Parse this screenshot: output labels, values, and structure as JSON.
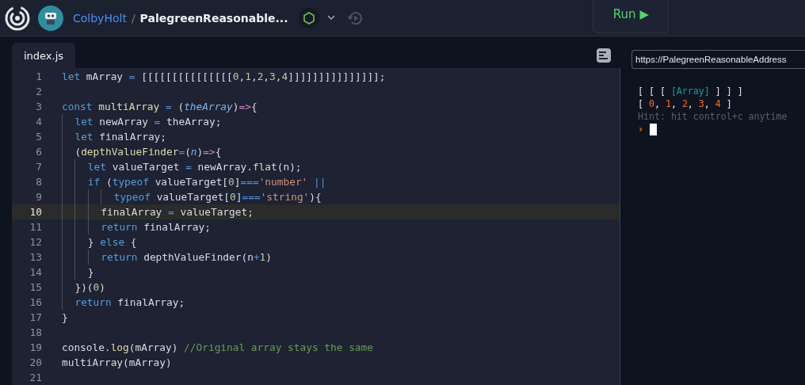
{
  "header": {
    "user": "ColbyHolt",
    "separator": "/",
    "repl_name": "PalegreenReasonable...",
    "run_button": {
      "label": "Run",
      "icon": "▶"
    }
  },
  "editor": {
    "tabs": [
      {
        "label": "index.js",
        "selected": true
      }
    ],
    "lines": [
      {
        "number": "1",
        "current": false,
        "tokens": [
          {
            "kind": "kw",
            "text": "let"
          },
          {
            "kind": "plain",
            "text": " mArray "
          },
          {
            "kind": "op",
            "text": "="
          },
          {
            "kind": "plain",
            "text": " [[[[[[[[[[[[[[["
          },
          {
            "kind": "num",
            "text": "0"
          },
          {
            "kind": "plain",
            "text": ","
          },
          {
            "kind": "num",
            "text": "1"
          },
          {
            "kind": "plain",
            "text": ","
          },
          {
            "kind": "num",
            "text": "2"
          },
          {
            "kind": "plain",
            "text": ","
          },
          {
            "kind": "num",
            "text": "3"
          },
          {
            "kind": "plain",
            "text": ","
          },
          {
            "kind": "num",
            "text": "4"
          },
          {
            "kind": "plain",
            "text": "]]]]]]]]]]]]]]];"
          }
        ]
      },
      {
        "number": "2",
        "current": false
      },
      {
        "number": "3",
        "current": false,
        "tokens": [
          {
            "kind": "kw",
            "text": "const "
          },
          {
            "kind": "fn",
            "text": "multiArray"
          },
          {
            "kind": "op",
            "text": " = "
          },
          {
            "kind": "plain",
            "text": "("
          },
          {
            "kind": "param",
            "text": "theArray"
          },
          {
            "kind": "plain",
            "text": ")"
          },
          {
            "kind": "arrow",
            "text": "=>"
          },
          {
            "kind": "plain",
            "text": "{"
          }
        ]
      },
      {
        "number": "4",
        "current": false,
        "tokens": [
          {
            "kind": "kw",
            "text": "  let"
          },
          {
            "kind": "plain",
            "text": " newArray "
          },
          {
            "kind": "op",
            "text": "="
          },
          {
            "kind": "plain",
            "text": " theArray;"
          }
        ]
      },
      {
        "number": "5",
        "current": false,
        "tokens": [
          {
            "kind": "kw",
            "text": "  let"
          },
          {
            "kind": "plain",
            "text": " finalArray;"
          }
        ]
      },
      {
        "number": "6",
        "current": false,
        "tokens": [
          {
            "kind": "plain",
            "text": "  ("
          },
          {
            "kind": "fn",
            "text": "depthValueFinder"
          },
          {
            "kind": "op",
            "text": "="
          },
          {
            "kind": "plain",
            "text": "("
          },
          {
            "kind": "param",
            "text": "n"
          },
          {
            "kind": "plain",
            "text": ")"
          },
          {
            "kind": "arrow",
            "text": "=>"
          },
          {
            "kind": "plain",
            "text": "{"
          }
        ]
      },
      {
        "number": "7",
        "current": false,
        "tokens": [
          {
            "kind": "kw",
            "text": "    let"
          },
          {
            "kind": "plain",
            "text": " valueTarget "
          },
          {
            "kind": "op",
            "text": "="
          },
          {
            "kind": "plain",
            "text": " newArray."
          },
          {
            "kind": "fn",
            "text": "flat"
          },
          {
            "kind": "plain",
            "text": "(n);"
          }
        ]
      },
      {
        "number": "8",
        "current": false,
        "tokens": [
          {
            "kind": "kw",
            "text": "    if"
          },
          {
            "kind": "plain",
            "text": " ("
          },
          {
            "kind": "kw",
            "text": "typeof"
          },
          {
            "kind": "plain",
            "text": " valueTarget["
          },
          {
            "kind": "num",
            "text": "0"
          },
          {
            "kind": "plain",
            "text": "]"
          },
          {
            "kind": "op",
            "text": "==="
          },
          {
            "kind": "str",
            "text": "'number'"
          },
          {
            "kind": "op",
            "text": " ||"
          }
        ]
      },
      {
        "number": "9",
        "current": false,
        "tokens": [
          {
            "kind": "kw",
            "text": "        typeof"
          },
          {
            "kind": "plain",
            "text": " valueTarget["
          },
          {
            "kind": "num",
            "text": "0"
          },
          {
            "kind": "plain",
            "text": "]"
          },
          {
            "kind": "op",
            "text": "==="
          },
          {
            "kind": "str",
            "text": "'string'"
          },
          {
            "kind": "plain",
            "text": "){"
          }
        ]
      },
      {
        "number": "10",
        "current": true,
        "tokens": [
          {
            "kind": "plain",
            "text": "      finalArray "
          },
          {
            "kind": "op",
            "text": "="
          },
          {
            "kind": "plain",
            "text": " valueTarget;"
          }
        ]
      },
      {
        "number": "11",
        "current": false,
        "tokens": [
          {
            "kind": "kw",
            "text": "      return"
          },
          {
            "kind": "plain",
            "text": " finalArray;"
          }
        ]
      },
      {
        "number": "12",
        "current": false,
        "tokens": [
          {
            "kind": "plain",
            "text": "    } "
          },
          {
            "kind": "kw",
            "text": "else"
          },
          {
            "kind": "plain",
            "text": " {"
          }
        ]
      },
      {
        "number": "13",
        "current": false,
        "tokens": [
          {
            "kind": "kw",
            "text": "      return"
          },
          {
            "kind": "plain",
            "text": " depthValueFinder(n"
          },
          {
            "kind": "op",
            "text": "+"
          },
          {
            "kind": "num",
            "text": "1"
          },
          {
            "kind": "plain",
            "text": ")"
          }
        ]
      },
      {
        "number": "14",
        "current": false,
        "tokens": [
          {
            "kind": "plain",
            "text": "    }"
          }
        ]
      },
      {
        "number": "15",
        "current": false,
        "tokens": [
          {
            "kind": "plain",
            "text": "  })("
          },
          {
            "kind": "num",
            "text": "0"
          },
          {
            "kind": "plain",
            "text": ")"
          }
        ]
      },
      {
        "number": "16",
        "current": false,
        "tokens": [
          {
            "kind": "kw",
            "text": "  return"
          },
          {
            "kind": "plain",
            "text": " finalArray;"
          }
        ]
      },
      {
        "number": "17",
        "current": false,
        "tokens": [
          {
            "kind": "plain",
            "text": "}"
          }
        ]
      },
      {
        "number": "18",
        "current": false
      },
      {
        "number": "19",
        "current": false,
        "tokens": [
          {
            "kind": "plain",
            "text": "console."
          },
          {
            "kind": "fn",
            "text": "log"
          },
          {
            "kind": "plain",
            "text": "(mArray) "
          },
          {
            "kind": "comment",
            "text": "//Original array stays the same"
          }
        ]
      },
      {
        "number": "20",
        "current": false,
        "tokens": [
          {
            "kind": "plain",
            "text": "multiArray(mArray)"
          }
        ]
      },
      {
        "number": "21",
        "current": false
      }
    ]
  },
  "console": {
    "url": "https://PalegreenReasonableAddress",
    "lines": [
      {
        "tokens": [
          {
            "kind": "bracket",
            "text": "[ [ [ "
          },
          {
            "kind": "special",
            "text": "[Array]"
          },
          {
            "kind": "bracket",
            "text": " ] ] ]"
          }
        ]
      },
      {
        "tokens": [
          {
            "kind": "bracket",
            "text": "[ "
          },
          {
            "kind": "num",
            "text": "0"
          },
          {
            "kind": "bracket",
            "text": ", "
          },
          {
            "kind": "num",
            "text": "1"
          },
          {
            "kind": "bracket",
            "text": ", "
          },
          {
            "kind": "num",
            "text": "2"
          },
          {
            "kind": "bracket",
            "text": ", "
          },
          {
            "kind": "num",
            "text": "3"
          },
          {
            "kind": "bracket",
            "text": ", "
          },
          {
            "kind": "num",
            "text": "4"
          },
          {
            "kind": "bracket",
            "text": " ]"
          }
        ]
      },
      {
        "tokens": [
          {
            "kind": "hint",
            "text": "Hint: hit control+c anytime"
          }
        ]
      }
    ],
    "prompt": "›"
  }
}
